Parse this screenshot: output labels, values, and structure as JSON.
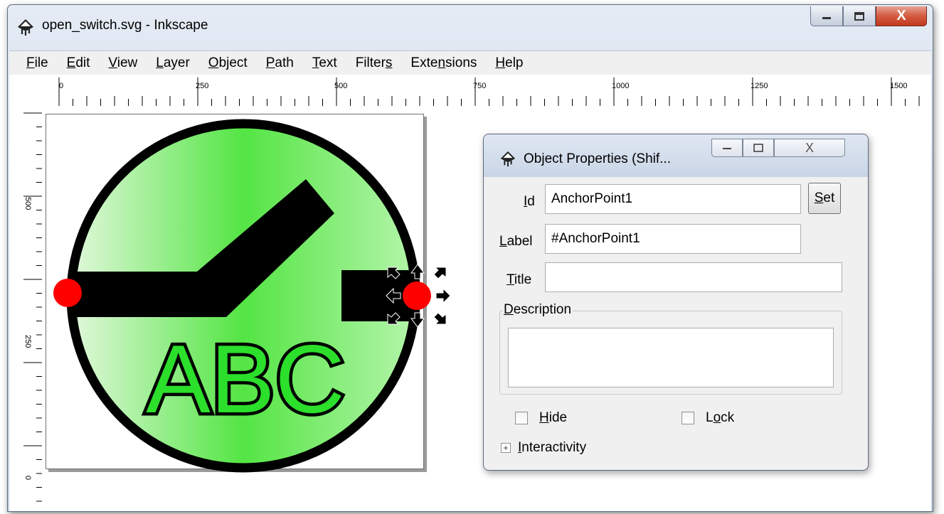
{
  "window": {
    "title": "open_switch.svg - Inkscape",
    "close_glyph": "X"
  },
  "menu": {
    "items": [
      {
        "label_pre": "",
        "key": "F",
        "label_post": "ile"
      },
      {
        "label_pre": "",
        "key": "E",
        "label_post": "dit"
      },
      {
        "label_pre": "",
        "key": "V",
        "label_post": "iew"
      },
      {
        "label_pre": "",
        "key": "L",
        "label_post": "ayer"
      },
      {
        "label_pre": "",
        "key": "O",
        "label_post": "bject"
      },
      {
        "label_pre": "",
        "key": "P",
        "label_post": "ath"
      },
      {
        "label_pre": "",
        "key": "T",
        "label_post": "ext"
      },
      {
        "label_pre": "Filter",
        "key": "s",
        "label_post": ""
      },
      {
        "label_pre": "Exte",
        "key": "n",
        "label_post": "sions"
      },
      {
        "label_pre": "",
        "key": "H",
        "label_post": "elp"
      }
    ]
  },
  "rulers": {
    "horizontal_labels": [
      "0",
      "250",
      "500",
      "750",
      "1000",
      "1250",
      "1500"
    ],
    "vertical_labels": [
      "500",
      "250",
      "0"
    ]
  },
  "drawing": {
    "text": "ABC",
    "colors": {
      "circle_fill_light": "#d7f5d0",
      "circle_fill_mid": "#74e966",
      "circle_stroke": "#000000",
      "anchor_fill": "#ff0000",
      "text_fill": "#2bdf2b"
    }
  },
  "dialog": {
    "title": "Object Properties (Shif...",
    "id_label": "Id",
    "id_value": "AnchorPoint1",
    "set_label": "Set",
    "label_label": "Label",
    "label_value": "#AnchorPoint1",
    "title_label": "Title",
    "title_value": "",
    "description_label": "Description",
    "description_value": "",
    "hide_label": "Hide",
    "lock_label": "Lock",
    "interactivity_label": "Interactivity",
    "expander_glyph": "+",
    "close_glyph": "X"
  }
}
